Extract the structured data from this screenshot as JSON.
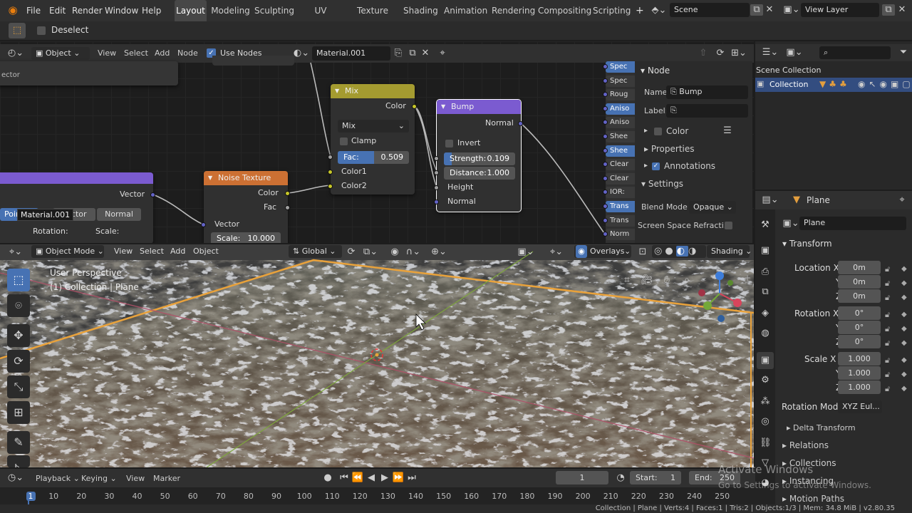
{
  "topbar": {
    "menus": [
      "File",
      "Edit",
      "Render",
      "Window",
      "Help"
    ],
    "workspaces": [
      "Layout",
      "Modeling",
      "Sculpting",
      "UV Editing",
      "Texture Paint",
      "Shading",
      "Animation",
      "Rendering",
      "Compositing",
      "Scripting"
    ],
    "add_tab": "+",
    "scene": "Scene",
    "view_layer": "View Layer"
  },
  "toolheader": {
    "deselect": "Deselect"
  },
  "node_editor": {
    "header": {
      "mode": "Object",
      "menus": [
        "View",
        "Select",
        "Add",
        "Node"
      ],
      "use_nodes": "Use Nodes",
      "material": "Material.001"
    },
    "partial_node_label": "ector",
    "nodes": {
      "mix": {
        "title": "Mix",
        "out_color": "Color",
        "blend": "Mix",
        "clamp": "Clamp",
        "fac_label": "Fac:",
        "fac_value": "0.509",
        "fac_fraction": 0.509,
        "in1": "Color1",
        "in2": "Color2"
      },
      "bump": {
        "title": "Bump",
        "out_normal": "Normal",
        "invert": "Invert",
        "strength_label": "Strength:",
        "strength_value": "0.109",
        "strength_fraction": 0.109,
        "distance_label": "Distance:",
        "distance_value": "1.000",
        "in_height": "Height",
        "in_normal": "Normal"
      },
      "noise": {
        "title": "Noise Texture",
        "out_color": "Color",
        "out_fac": "Fac",
        "in_vector": "Vector",
        "scale_label": "Scale:",
        "scale_value": "10.000"
      },
      "mapping": {
        "out_vector": "Vector",
        "tooltip": "Material.001",
        "b1": "Point",
        "b2": "Vector",
        "b3": "Normal",
        "rotation": "Rotation:",
        "scale": "Scale:"
      }
    },
    "bsdf_tabs": [
      "Spec",
      "Spec",
      "Roug",
      "Aniso",
      "Aniso",
      "Shee",
      "Shee",
      "Clear",
      "Clear",
      "IOR:",
      "Trans",
      "Trans",
      "Norm"
    ],
    "sidebar": {
      "section": "Node",
      "name_label": "Name:",
      "name_value": "Bump",
      "label_label": "Label:",
      "color": "Color",
      "properties": "Properties",
      "annotations": "Annotations",
      "settings": "Settings",
      "blend_mode_label": "Blend Mode",
      "blend_mode": "Opaque",
      "ssr": "Screen Space Refracti..."
    }
  },
  "outliner": {
    "scene_collection": "Scene Collection",
    "collection": "Collection"
  },
  "properties": {
    "object": "Plane",
    "datablock": "Plane",
    "transform": "Transform",
    "location": {
      "x_label": "Location X",
      "y_label": "Y",
      "z_label": "Z",
      "x": "0m",
      "y": "0m",
      "z": "0m"
    },
    "rotation": {
      "x_label": "Rotation X",
      "y_label": "Y",
      "z_label": "Z",
      "x": "0°",
      "y": "0°",
      "z": "0°"
    },
    "scale": {
      "x_label": "Scale X",
      "y_label": "Y",
      "z_label": "Z",
      "x": "1.000",
      "y": "1.000",
      "z": "1.000"
    },
    "rotation_mode_label": "Rotation Mode",
    "rotation_mode": "XYZ Eul...",
    "delta": "Delta Transform",
    "relations": "Relations",
    "collections": "Collections",
    "instancing": "Instancing",
    "motion_paths": "Motion Paths"
  },
  "viewport": {
    "header": {
      "mode": "Object Mode",
      "menus": [
        "View",
        "Select",
        "Add",
        "Object"
      ],
      "orientation": "Global",
      "overlays": "Overlays",
      "shading": "Shading"
    },
    "perspective": "User Perspective",
    "collection_info": "(1) Collection | Plane"
  },
  "timeline": {
    "menus": [
      "Playback",
      "Keying",
      "View",
      "Marker"
    ],
    "current_frame": "1",
    "start_label": "Start:",
    "start": "1",
    "end_label": "End:",
    "end": "250",
    "ticks": [
      "1",
      "10",
      "20",
      "30",
      "40",
      "50",
      "60",
      "70",
      "80",
      "90",
      "100",
      "110",
      "120",
      "130",
      "140",
      "150",
      "160",
      "170",
      "180",
      "190",
      "200",
      "210",
      "220",
      "230",
      "240",
      "250"
    ]
  },
  "statusbar": {
    "text": "Collection | Plane | Verts:4 | Faces:1 | Tris:2 | Objects:1/3 | Mem: 34.8 MiB | v2.80.35"
  },
  "watermark": {
    "line1": "Activate Windows",
    "line2": "Go to Settings to activate Windows."
  },
  "colors": {
    "accent": "#4772b3",
    "mix_header": "#a49b30",
    "bump_header": "#7b5bd0",
    "noise_header": "#cc7033",
    "selection": "#e9a23b"
  }
}
